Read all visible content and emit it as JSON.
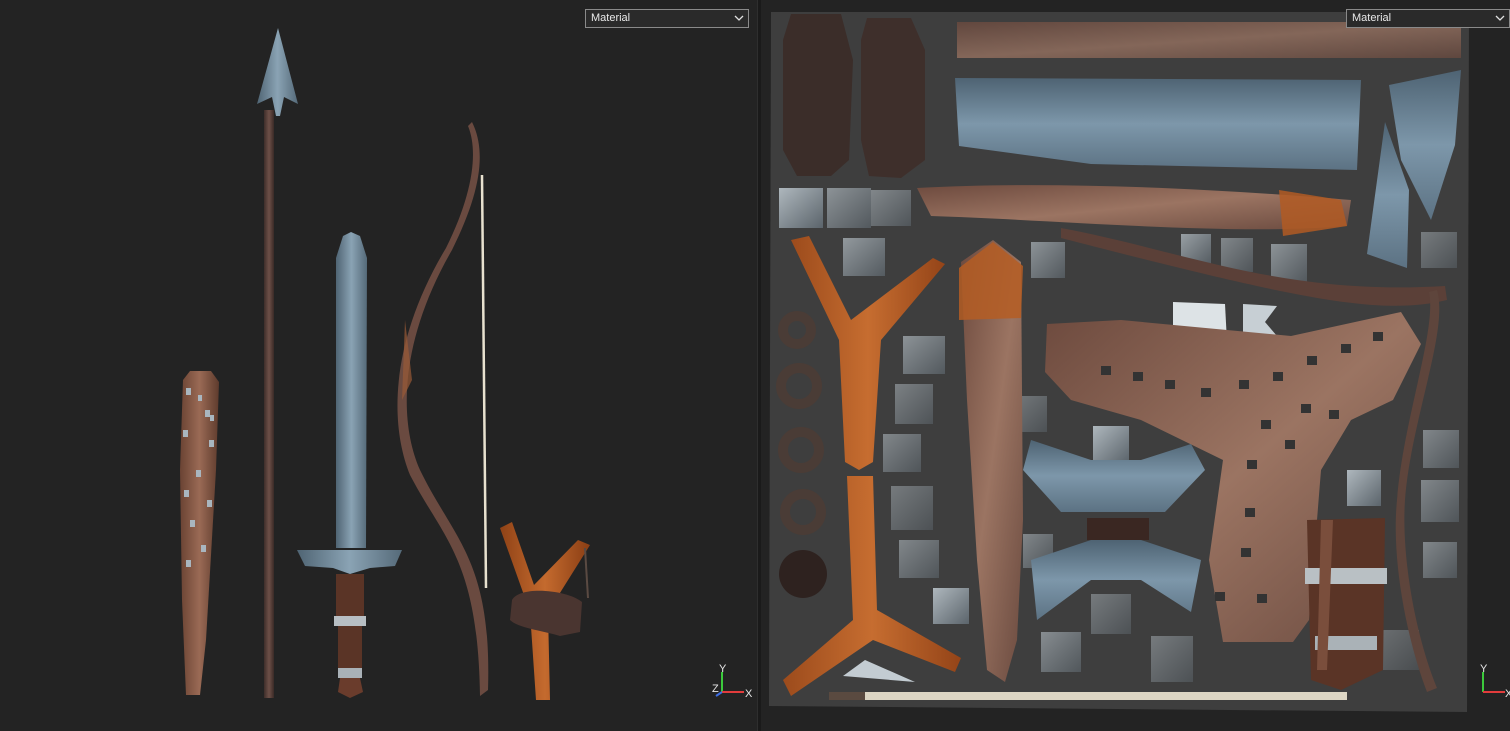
{
  "left_viewport": {
    "material_select": {
      "value": "Material",
      "options": [
        "Material"
      ]
    },
    "axis": {
      "x": "X",
      "y": "Y",
      "z": "Z"
    }
  },
  "right_viewport": {
    "material_select": {
      "value": "Material",
      "options": [
        "Material"
      ]
    },
    "axis": {
      "x": "X",
      "y": "Y"
    }
  },
  "colors": {
    "background": "#232323",
    "wood": "#7a5240",
    "orange_wood": "#b05a22",
    "steel": "#6f8798",
    "dark_leather": "#3a2c28",
    "uv_sheet": "#3f3f3f"
  },
  "icons": [
    "chevron-down-icon",
    "axis-gizmo-icon"
  ]
}
